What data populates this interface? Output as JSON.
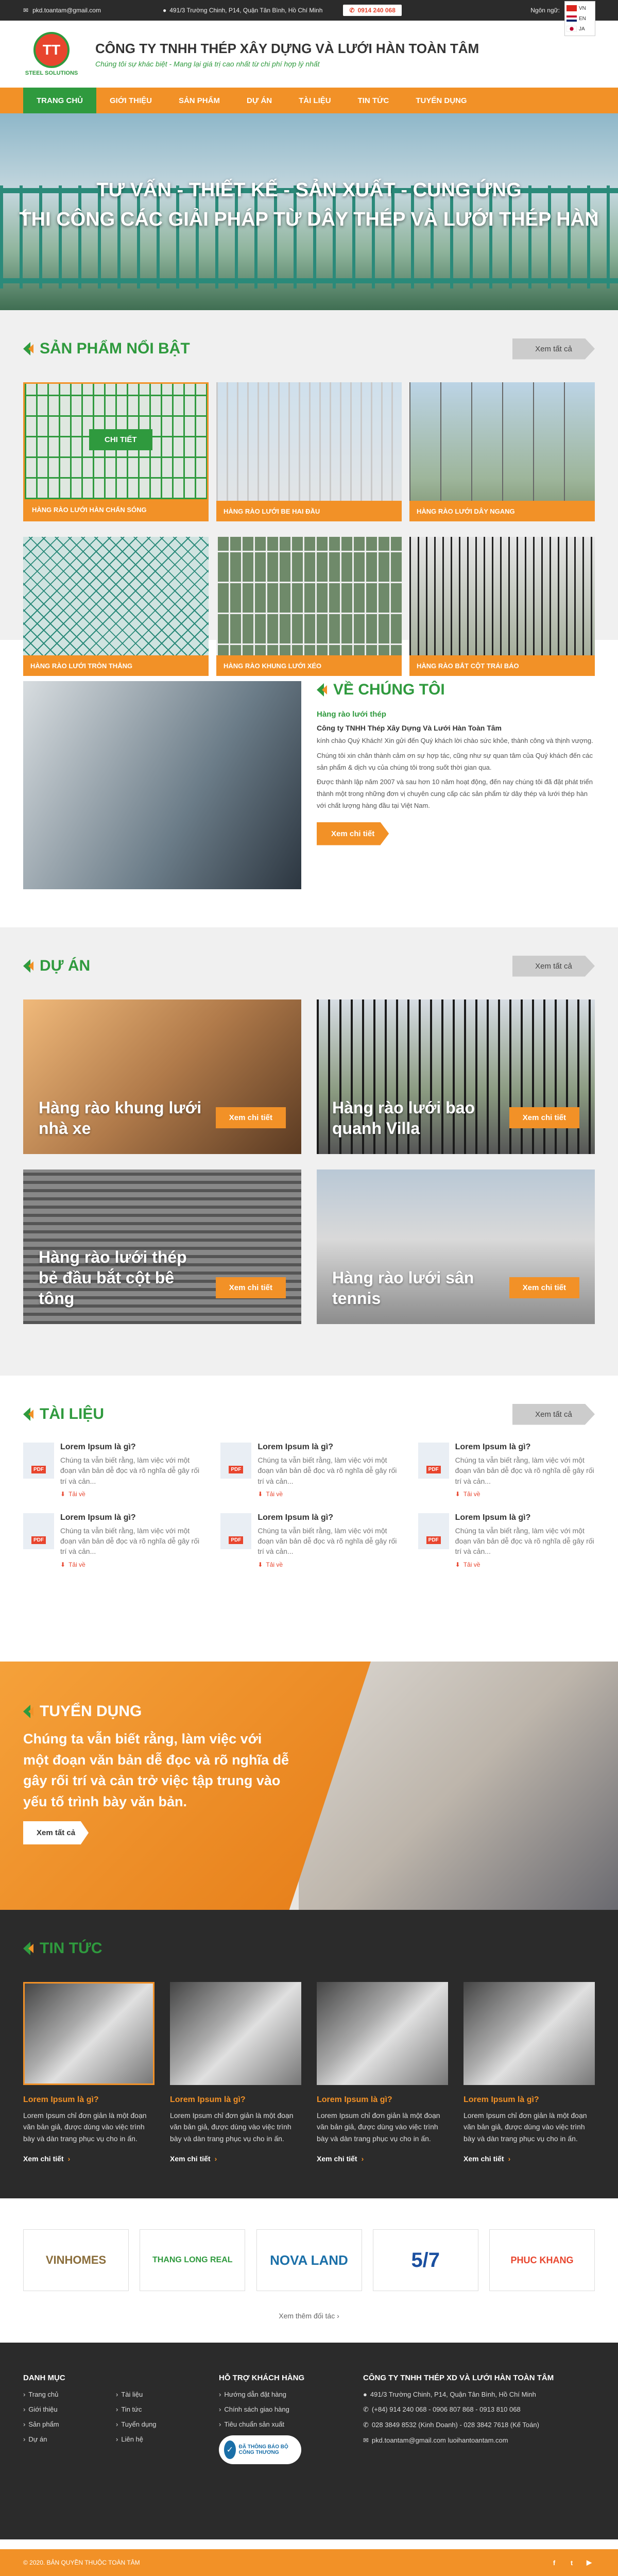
{
  "topbar": {
    "email": "pkd.toantam@gmail.com",
    "address": "491/3 Trường Chinh, P14, Quận Tân Bình, Hồ Chí Minh",
    "hotline": "0914 240 068",
    "lang_label": "Ngôn ngữ:",
    "langs": [
      "VN",
      "EN",
      "JA"
    ]
  },
  "header": {
    "logo_text": "STEEL SOLUTIONS",
    "company": "CÔNG TY TNHH THÉP XÂY DỰNG VÀ LƯỚI HÀN TOÀN TÂM",
    "tagline": "Chúng tôi sự khác biệt  -  Mang lại giá trị cao nhất từ chi phí hợp lý nhất"
  },
  "nav": [
    "TRANG CHỦ",
    "GIỚI THIỆU",
    "SẢN PHẨM",
    "DỰ ÁN",
    "TÀI LIỆU",
    "TIN TỨC",
    "TUYỂN DỤNG"
  ],
  "hero": {
    "line1": "TƯ VẤN - THIẾT KẾ - SẢN XUẤT - CUNG ỨNG",
    "line2": "THI CÔNG CÁC GIẢI PHÁP TỪ DÂY THÉP VÀ LƯỚI THÉP HÀN",
    "prev": "‹",
    "next": "›"
  },
  "products": {
    "title": "SẢN PHẨM NỔI BẬT",
    "more": "Xem tất cả",
    "detail": "CHI TIẾT",
    "items": [
      "HÀNG RÀO LƯỚI HÀN CHẤN SÓNG",
      "HÀNG RÀO LƯỚI BE HAI ĐẦU",
      "HÀNG RÀO LƯỚI DÂY NGANG",
      "HÀNG RÀO LƯỚI TRÒN THẲNG",
      "HÀNG RÀO KHUNG LƯỚI XÉO",
      "HÀNG RÀO BẮT CỘT TRÁI BÁO"
    ]
  },
  "about": {
    "title": "VỀ CHÚNG TÔI",
    "kicker": "Hàng rào lưới thép",
    "company": "Công ty TNHH Thép Xây Dựng Và Lưới Hàn Toàn Tâm",
    "p1": "kính chào Quý Khách! Xin gửi đến Quý khách lời chào sức khỏe, thành công và thịnh vượng.",
    "p2": "Chúng tôi xin chân thành cảm ơn sự hợp tác, cũng như sự quan tâm của Quý khách đến các sản phẩm & dịch vụ của chúng tôi trong suốt thời gian qua.",
    "p3": "Được thành lập năm 2007 và sau hơn 10 năm hoạt động, đến nay chúng tôi đã đặt phát triển thành một trong những đơn vị chuyên cung cấp các sản phẩm từ dây thép và lưới thép hàn với chất lượng hàng đầu tại Việt Nam.",
    "btn": "Xem chi tiết"
  },
  "projects": {
    "title": "DỰ ÁN",
    "more": "Xem tất cả",
    "btn": "Xem chi tiết",
    "items": [
      "Hàng rào khung lưới nhà xe",
      "Hàng rào lưới bao quanh Villa",
      "Hàng rào lưới thép bẻ đầu bắt cột bê tông",
      "Hàng rào lưới sân tennis"
    ]
  },
  "docs": {
    "title": "TÀI LIỆU",
    "more": "Xem tất cả",
    "badge": "PDF",
    "item_title": "Lorem Ipsum là gì?",
    "item_desc": "Chúng ta vẫn biết rằng, làm việc với một đoạn văn bản dễ đọc và rõ nghĩa dễ gây rối trí và cản...",
    "download": "Tải về"
  },
  "careers": {
    "title": "TUYỂN DỤNG",
    "desc": "Chúng ta vẫn biết rằng, làm việc với một đoạn văn bản dễ đọc và rõ nghĩa dễ gây rối trí và cản trở việc tập trung vào yếu tố trình bày văn bản.",
    "btn": "Xem tất cả"
  },
  "news": {
    "title": "TIN TỨC",
    "item_title": "Lorem Ipsum là gì?",
    "item_desc": "Lorem Ipsum chỉ đơn giản là một đoạn văn bản giả, được dùng vào việc trình bày và dàn trang phục vụ cho in ấn.",
    "more": "Xem chi tiết"
  },
  "partners": {
    "logos": [
      "VINHOMES",
      "THANG LONG REAL",
      "NOVA LAND",
      "5/7",
      "PHUC KHANG"
    ],
    "more": "Xem thêm đối tác"
  },
  "footer": {
    "menu_title": "DANH MỤC",
    "menu": [
      "Trang chủ",
      "Giới thiệu",
      "Sản phẩm",
      "Dự án",
      "Tài liệu",
      "Tin tức",
      "Tuyển dụng",
      "Liên hệ"
    ],
    "support_title": "HỖ TRỢ KHÁCH HÀNG",
    "support": [
      "Hướng dẫn đặt hàng",
      "Chính sách giao hàng",
      "Tiêu chuẩn sản xuất"
    ],
    "badge": "ĐÃ THÔNG BÁO BỘ CÔNG THƯƠNG",
    "contact_title": "CÔNG TY TNHH THÉP XD VÀ LƯỚI HÀN TOÀN TÂM",
    "contact": [
      "491/3 Trường Chinh, P14, Quận Tân Bình, Hồ Chí Minh",
      "(+84) 914 240 068  -  0906 807 868  -  0913 810 068",
      "028 3849 8532 (Kinh Doanh)  -  028 3842 7618 (Kế Toán)",
      "pkd.toantam@gmail.com    luoihantoantam.com"
    ],
    "copyright": "© 2020. BẢN QUYỀN THUỘC TOÀN TÂM"
  },
  "colors": {
    "orange": "#f29127",
    "green": "#2f9a3e",
    "dark": "#2b2b2b"
  }
}
